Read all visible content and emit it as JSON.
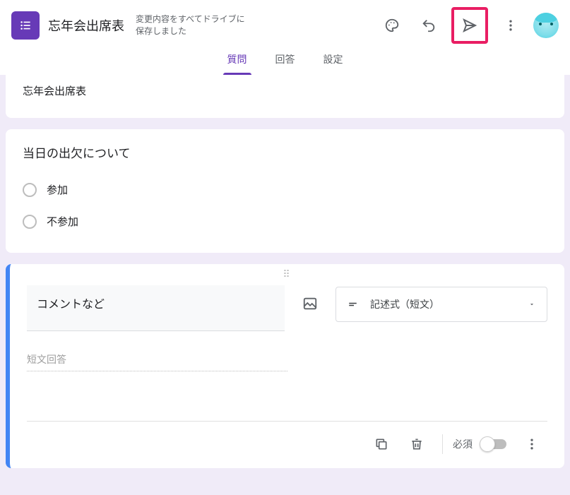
{
  "header": {
    "form_title": "忘年会出席表",
    "save_status_line1": "変更内容をすべてドライブに",
    "save_status_line2": "保存しました"
  },
  "tabs": {
    "questions": "質問",
    "responses": "回答",
    "settings": "設定"
  },
  "form_header_card": {
    "title": "忘年会出席表"
  },
  "attendance_card": {
    "heading": "当日の出欠について",
    "options": [
      "参加",
      "不参加"
    ]
  },
  "editing_card": {
    "question_value": "コメントなど",
    "type_label": "記述式（短文）",
    "answer_placeholder": "短文回答",
    "required_label": "必須"
  }
}
